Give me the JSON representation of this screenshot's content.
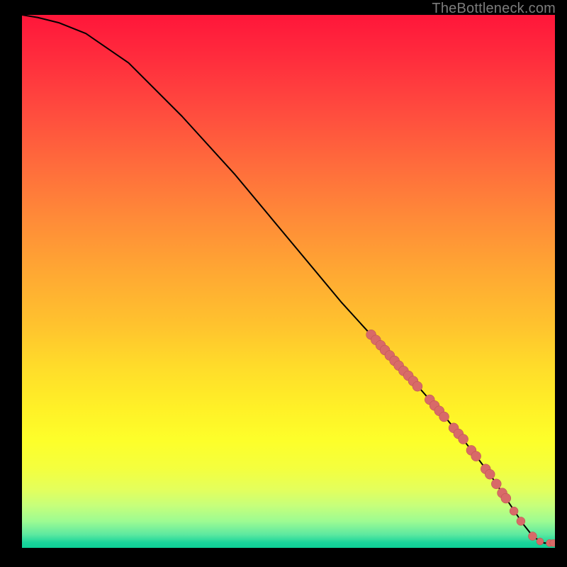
{
  "attribution": "TheBottleneck.com",
  "colors": {
    "marker_fill": "#d86a68",
    "marker_stroke": "#b94f4d",
    "line": "#000000",
    "page_bg": "#000000"
  },
  "chart_data": {
    "type": "line",
    "title": "",
    "xlabel": "",
    "ylabel": "",
    "xlim": [
      0,
      100
    ],
    "ylim": [
      0,
      100
    ],
    "grid": false,
    "line_series": {
      "name": "curve",
      "x": [
        0,
        3,
        7,
        12,
        20,
        30,
        40,
        50,
        60,
        65,
        70,
        75,
        80,
        85,
        88,
        90,
        92,
        94,
        96,
        98,
        100
      ],
      "values": [
        100,
        99.5,
        98.5,
        96.5,
        91,
        81,
        70,
        58,
        46,
        40.5,
        35,
        29.5,
        23.8,
        17.5,
        13.5,
        10.5,
        7.5,
        4.5,
        2,
        0.9,
        0.9
      ]
    },
    "markers": {
      "name": "highlighted-points",
      "points": [
        {
          "x": 65.5,
          "y": 40.0,
          "r": 7
        },
        {
          "x": 66.4,
          "y": 39.0,
          "r": 7
        },
        {
          "x": 67.3,
          "y": 38.0,
          "r": 7
        },
        {
          "x": 68.1,
          "y": 37.1,
          "r": 7
        },
        {
          "x": 69.0,
          "y": 36.1,
          "r": 7
        },
        {
          "x": 69.9,
          "y": 35.1,
          "r": 7
        },
        {
          "x": 70.7,
          "y": 34.2,
          "r": 7
        },
        {
          "x": 71.6,
          "y": 33.2,
          "r": 7
        },
        {
          "x": 72.5,
          "y": 32.3,
          "r": 7
        },
        {
          "x": 73.4,
          "y": 31.3,
          "r": 7
        },
        {
          "x": 74.2,
          "y": 30.3,
          "r": 7
        },
        {
          "x": 76.5,
          "y": 27.8,
          "r": 7
        },
        {
          "x": 77.4,
          "y": 26.7,
          "r": 7
        },
        {
          "x": 78.3,
          "y": 25.7,
          "r": 7
        },
        {
          "x": 79.2,
          "y": 24.6,
          "r": 7
        },
        {
          "x": 81.0,
          "y": 22.5,
          "r": 7
        },
        {
          "x": 81.9,
          "y": 21.4,
          "r": 7
        },
        {
          "x": 82.8,
          "y": 20.4,
          "r": 7
        },
        {
          "x": 84.3,
          "y": 18.3,
          "r": 7
        },
        {
          "x": 85.2,
          "y": 17.2,
          "r": 7
        },
        {
          "x": 87.0,
          "y": 14.8,
          "r": 7
        },
        {
          "x": 87.8,
          "y": 13.8,
          "r": 7
        },
        {
          "x": 89.0,
          "y": 12.0,
          "r": 7
        },
        {
          "x": 90.1,
          "y": 10.3,
          "r": 7
        },
        {
          "x": 90.8,
          "y": 9.3,
          "r": 7
        },
        {
          "x": 92.3,
          "y": 6.9,
          "r": 6
        },
        {
          "x": 93.6,
          "y": 5.0,
          "r": 6
        },
        {
          "x": 95.8,
          "y": 2.2,
          "r": 6
        },
        {
          "x": 97.2,
          "y": 1.2,
          "r": 5
        },
        {
          "x": 99.0,
          "y": 0.9,
          "r": 5
        },
        {
          "x": 99.7,
          "y": 0.9,
          "r": 5
        }
      ]
    }
  }
}
